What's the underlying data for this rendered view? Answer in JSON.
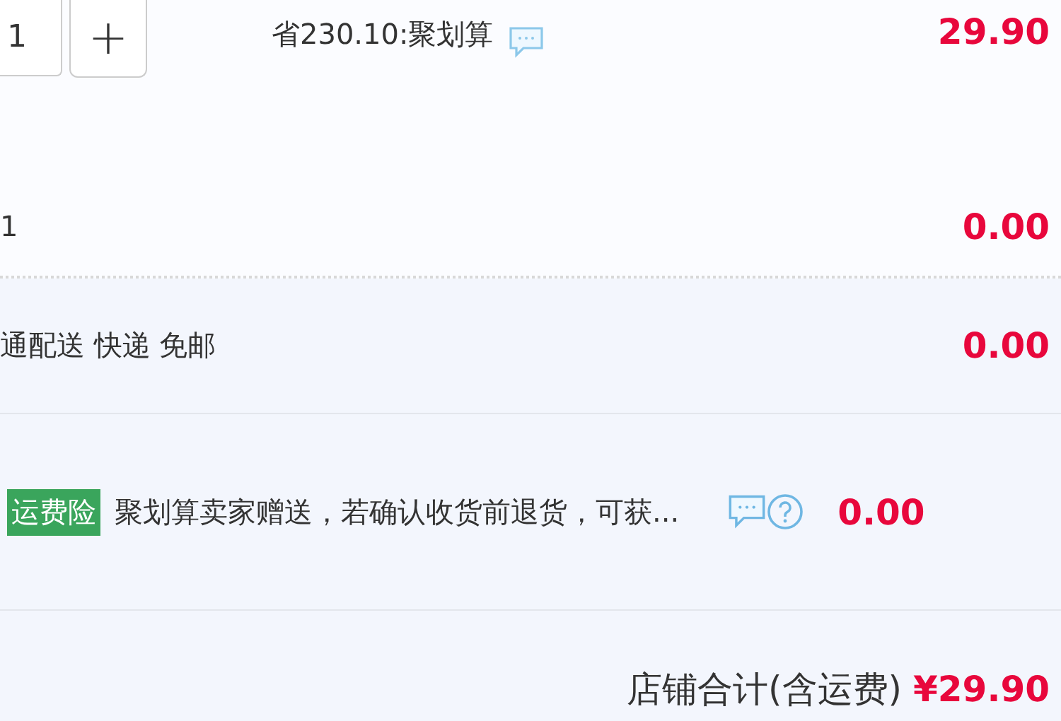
{
  "item": {
    "quantity": "1",
    "plus": "+",
    "promo": "省230.10:聚划算",
    "price": "29.90"
  },
  "quantity_row": {
    "value": "1",
    "price": "0.00"
  },
  "shipping": {
    "text": "通配送 快递 免邮",
    "price": "0.00"
  },
  "insurance": {
    "tag": "运费险",
    "text": "聚划算卖家赠送，若确认收货前退货，可获...",
    "price": "0.00"
  },
  "total": {
    "label": "店铺合计(含运费)",
    "amount": "¥29.90"
  }
}
